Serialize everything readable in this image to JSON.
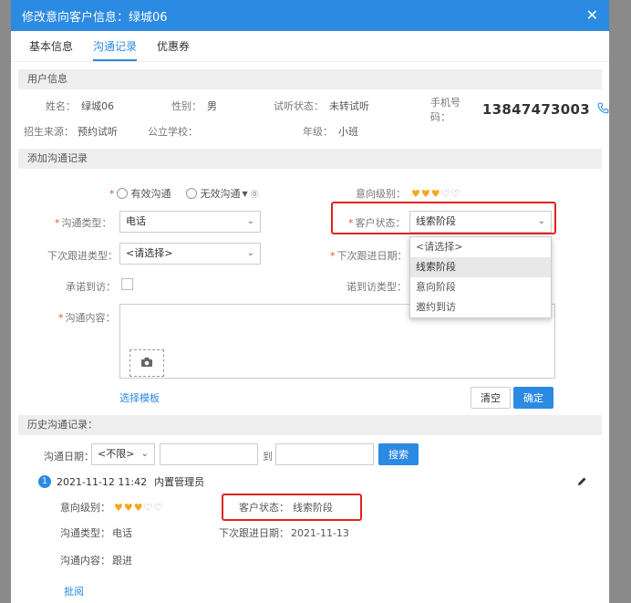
{
  "dialog": {
    "title": "修改意向客户信息：绿城06",
    "close_glyph": "✕",
    "tabs": [
      {
        "label": "基本信息"
      },
      {
        "label": "沟通记录"
      },
      {
        "label": "优惠券"
      }
    ]
  },
  "user_info": {
    "section_title": "用户信息",
    "name_label": "姓名：",
    "name_value": "绿城06",
    "gender_label": "性别：",
    "gender_value": "男",
    "trial_label": "试听状态：",
    "trial_value": "未转试听",
    "phone_label": "手机号码：",
    "phone_value": "13847473003",
    "source_label": "招生来源：",
    "source_value": "预约试听",
    "school_label": "公立学校：",
    "school_value": "",
    "grade_label": "年级：",
    "grade_value": "小班"
  },
  "add_record": {
    "section_title": "添加沟通记录",
    "valid_label": "有效沟通",
    "invalid_label": "无效沟通",
    "intent_label": "意向级别：",
    "intent_level": 3,
    "intent_max": 5,
    "comm_type_label": "沟通类型：",
    "comm_type_value": "电话",
    "customer_status_label": "客户状态：",
    "customer_status_value": "线索阶段",
    "next_type_label": "下次跟进类型：",
    "next_type_value": "<请选择>",
    "next_date_label": "下次跟进日期：",
    "promise_label": "承诺到访：",
    "promise_type_label": "诺到访类型：",
    "content_label": "沟通内容：",
    "template_link": "选择模板",
    "clear_button": "清空",
    "confirm_button": "确定",
    "status_options": [
      "<请选择>",
      "线索阶段",
      "意向阶段",
      "邀约到访"
    ],
    "status_selected_index": 1
  },
  "history": {
    "section_title": "历史沟通记录：",
    "date_label": "沟通日期：",
    "date_filter_value": "<不限>",
    "to_label": "到",
    "search_button": "搜索",
    "record": {
      "index": "1",
      "datetime": "2021-11-12 11:42",
      "operator": "内置管理员",
      "intent_label": "意向级别：",
      "intent_level": 3,
      "status_label": "客户状态：",
      "status_value": "线索阶段",
      "comm_type_label": "沟通类型：",
      "comm_type_value": "电话",
      "next_date_label": "下次跟进日期：",
      "next_date_value": "2021-11-13",
      "content_label": "沟通内容：",
      "content_value": "跟进",
      "review_link": "批阅"
    }
  },
  "colors": {
    "accent": "#2b8ae2",
    "required": "#e74c3c",
    "highlight_box": "#e0231f",
    "heart": "#f5a623"
  }
}
